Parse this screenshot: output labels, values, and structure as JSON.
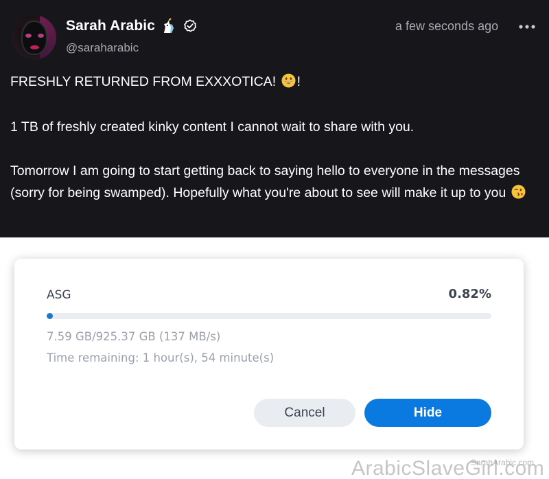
{
  "post": {
    "author": {
      "name": "Sarah Arabic",
      "handle": "@saraharabic",
      "badge_icons": [
        "unicorn-icon",
        "verified-check-icon"
      ]
    },
    "timestamp": "a few seconds ago",
    "more_icon": "more-horizontal-icon",
    "paragraphs": {
      "p1_text": "FRESHLY RETURNED FROM EXXXOTICA!",
      "p1_emoji": "grinning-face-icon",
      "p1_suffix": "!",
      "p2_text": "1 TB of freshly created kinky content I cannot wait to share with you.",
      "p3_text": "Tomorrow I am going to start getting back to saying hello to everyone in the messages (sorry for being swamped). Hopefully what you're about to see will make it up to you",
      "p3_emoji": "face-blowing-kiss-icon"
    }
  },
  "dialog": {
    "label": "ASG",
    "percent_text": "0.82%",
    "progress_fraction": 0.0082,
    "size_text": "7.59 GB/925.37 GB (137 MB/s)",
    "time_text": "Time remaining: 1 hour(s), 54 minute(s)",
    "cancel_label": "Cancel",
    "hide_label": "Hide",
    "accent_color": "#0b7ae0"
  },
  "watermarks": {
    "small": "SarahArabic.com",
    "large": "ArabicSlaveGirl.com"
  }
}
